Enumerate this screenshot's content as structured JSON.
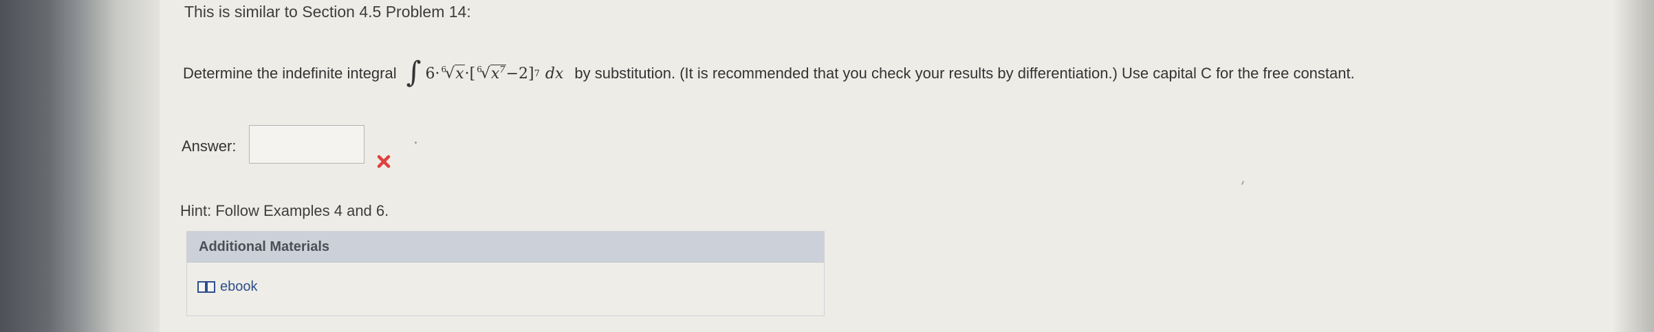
{
  "section_title": "This is similar to Section 4.5 Problem 14:",
  "question": {
    "prefix": "Determine the indefinite integral",
    "integrand": {
      "sign": "∫",
      "coefficient": "6·",
      "root_index": "6",
      "radicand": "x",
      "middle": "·[",
      "inner_root_index": "6",
      "inner_radicand": "x",
      "inner_power": "7",
      "tail": "−2]",
      "outer_power": "7",
      "differential": "dx"
    },
    "suffix": "by substitution. (It is recommended that you check your results by differentiation.) Use capital C for the free constant."
  },
  "answer": {
    "label": "Answer:",
    "value": "",
    "status": "incorrect"
  },
  "hint": "Hint: Follow Examples 4 and 6.",
  "additional_materials": {
    "title": "Additional Materials",
    "links": [
      {
        "label": "ebook",
        "icon": "book-icon"
      }
    ]
  },
  "colors": {
    "incorrect": "#e0403c",
    "link": "#2e4f8a",
    "materials_header": "#ccd0d8"
  }
}
